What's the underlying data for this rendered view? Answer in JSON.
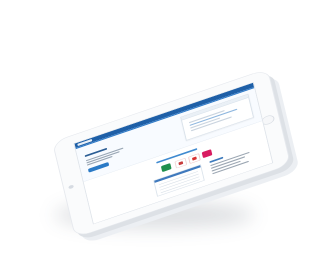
{
  "device": {
    "type": "tablet",
    "color": "#ffffff"
  },
  "colors": {
    "topbar": "#1e5fa7",
    "accent": "#2b7ac6",
    "excel": "#1f8f4d",
    "access": "#c83b3b",
    "pdf": "#d83131",
    "other": "#d81b60"
  },
  "icons": [
    "excel-icon",
    "access-icon",
    "pdf-icon",
    "pink-app-icon",
    "home-button-icon",
    "camera-icon"
  ]
}
